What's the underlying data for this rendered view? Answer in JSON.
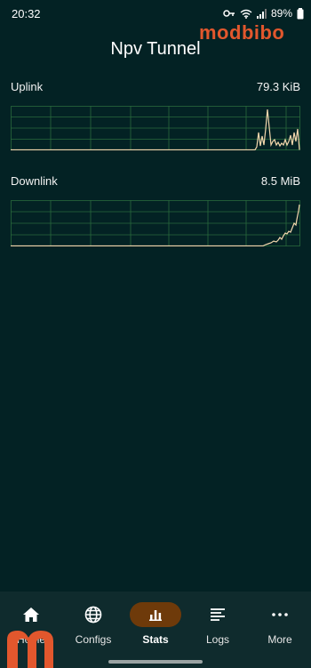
{
  "status_bar": {
    "time": "20:32",
    "battery": "89%"
  },
  "app": {
    "title": "Npv Tunnel"
  },
  "watermark": {
    "text": "modbibo"
  },
  "stats": {
    "uplink": {
      "label": "Uplink",
      "value": "79.3 KiB"
    },
    "downlink": {
      "label": "Downlink",
      "value": "8.5 MiB"
    }
  },
  "nav": {
    "items": [
      {
        "label": "Home",
        "icon": "home-icon"
      },
      {
        "label": "Configs",
        "icon": "globe-icon"
      },
      {
        "label": "Stats",
        "icon": "bar-chart-icon",
        "active": true
      },
      {
        "label": "Logs",
        "icon": "logs-icon"
      },
      {
        "label": "More",
        "icon": "more-icon"
      }
    ]
  },
  "colors": {
    "background": "#032224",
    "grid": "#2a6a3c",
    "trace": "#f3d7ad",
    "accent": "#6e3a0a",
    "watermark": "#e2572d"
  }
}
